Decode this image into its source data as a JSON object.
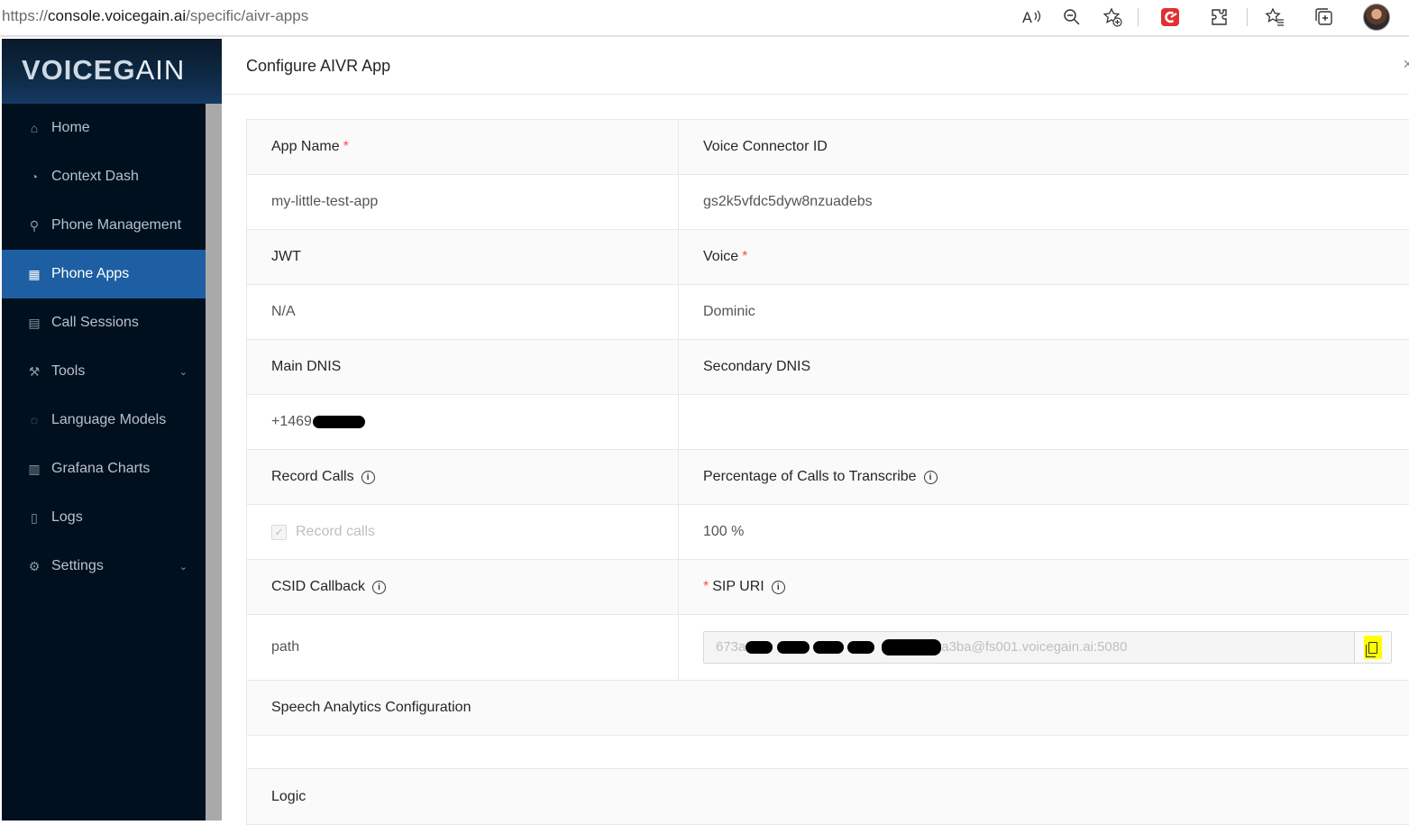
{
  "browser": {
    "url_prefix": "https://",
    "url_host": "console.voicegain.ai",
    "url_path": "/specific/aivr-apps",
    "icons": [
      "read-aloud-icon",
      "zoom-out-icon",
      "add-favorite-icon",
      "extension-red-icon",
      "extensions-icon",
      "favorites-icon",
      "collections-icon",
      "profile-avatar"
    ]
  },
  "sidebar": {
    "logo_bold": "VOICEG",
    "logo_light": "AIN",
    "items": [
      {
        "label": "Home",
        "icon": "home-icon",
        "glyph": "⌂",
        "active": false,
        "has_submenu": false
      },
      {
        "label": "Context Dash",
        "icon": "dashboard-icon",
        "glyph": "◔",
        "active": false,
        "has_submenu": false
      },
      {
        "label": "Phone Management",
        "icon": "link-icon",
        "glyph": "⚲",
        "active": false,
        "has_submenu": false
      },
      {
        "label": "Phone Apps",
        "icon": "table-icon",
        "glyph": "▦",
        "active": true,
        "has_submenu": false
      },
      {
        "label": "Call Sessions",
        "icon": "profile-icon",
        "glyph": "▤",
        "active": false,
        "has_submenu": false
      },
      {
        "label": "Tools",
        "icon": "tool-icon",
        "glyph": "⚒",
        "active": false,
        "has_submenu": true
      },
      {
        "label": "Language Models",
        "icon": "message-icon",
        "glyph": "◌",
        "active": false,
        "has_submenu": false
      },
      {
        "label": "Grafana Charts",
        "icon": "bar-chart-icon",
        "glyph": "▥",
        "active": false,
        "has_submenu": false
      },
      {
        "label": "Logs",
        "icon": "file-icon",
        "glyph": "▯",
        "active": false,
        "has_submenu": false
      },
      {
        "label": "Settings",
        "icon": "settings-icon",
        "glyph": "⚙",
        "active": false,
        "has_submenu": true
      }
    ]
  },
  "page": {
    "title": "Configure AIVR App",
    "close_glyph": "×"
  },
  "form": {
    "app_name_label": "App Name",
    "app_name_value": "my-little-test-app",
    "voice_connector_label": "Voice Connector ID",
    "voice_connector_value": "gs2k5vfdc5dyw8nzuadebs",
    "jwt_label": "JWT",
    "jwt_value": "N/A",
    "voice_label": "Voice",
    "voice_value": "Dominic",
    "main_dnis_label": "Main DNIS",
    "main_dnis_value": "+1469",
    "secondary_dnis_label": "Secondary DNIS",
    "secondary_dnis_value": "",
    "record_calls_label": "Record Calls",
    "record_calls_checkbox_label": "Record calls",
    "record_calls_checked": true,
    "percentage_label": "Percentage of Calls to Transcribe",
    "percentage_value": "100 %",
    "csid_label": "CSID Callback",
    "csid_value": "path",
    "sip_uri_label": "SIP URI",
    "sip_uri_prefix": "673a",
    "sip_uri_suffix": "a3ba@fs001.voicegain.ai:5080",
    "speech_analytics_label": "Speech Analytics Configuration",
    "speech_analytics_value": "",
    "logic_label": "Logic",
    "required_mark": "*",
    "info_glyph": "i",
    "check_glyph": "✓"
  },
  "colors": {
    "sidebar_bg": "#01101f",
    "active_item": "#1e5fa3",
    "required": "#ff4d4f",
    "copy_highlight": "#ffff00"
  }
}
